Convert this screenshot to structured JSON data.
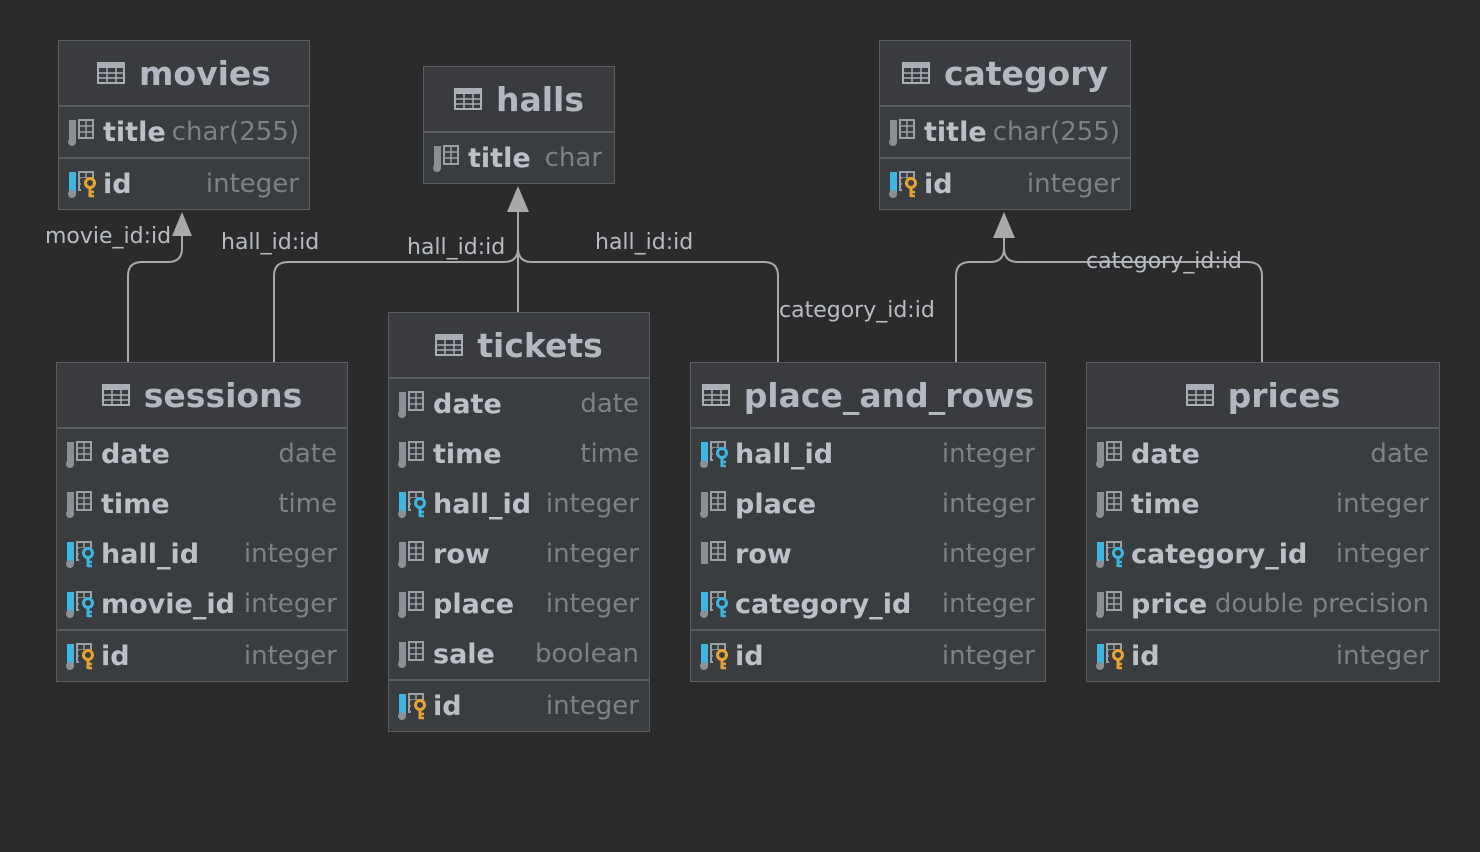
{
  "tables": {
    "movies": {
      "name": "movies",
      "columns": [
        {
          "name": "title",
          "type": "char(255)",
          "icon": "column-icon"
        }
      ],
      "pk": {
        "name": "id",
        "type": "integer",
        "icon": "primary-key-icon"
      }
    },
    "halls": {
      "name": "halls",
      "columns": [
        {
          "name": "title",
          "type": "char",
          "icon": "column-icon"
        }
      ]
    },
    "category": {
      "name": "category",
      "columns": [
        {
          "name": "title",
          "type": "char(255)",
          "icon": "column-icon"
        }
      ],
      "pk": {
        "name": "id",
        "type": "integer",
        "icon": "primary-key-icon"
      }
    },
    "sessions": {
      "name": "sessions",
      "columns": [
        {
          "name": "date",
          "type": "date",
          "icon": "column-icon"
        },
        {
          "name": "time",
          "type": "time",
          "icon": "column-icon"
        },
        {
          "name": "hall_id",
          "type": "integer",
          "icon": "foreign-key-icon"
        },
        {
          "name": "movie_id",
          "type": "integer",
          "icon": "foreign-key-icon"
        }
      ],
      "pk": {
        "name": "id",
        "type": "integer",
        "icon": "primary-key-icon"
      }
    },
    "tickets": {
      "name": "tickets",
      "columns": [
        {
          "name": "date",
          "type": "date",
          "icon": "column-icon"
        },
        {
          "name": "time",
          "type": "time",
          "icon": "column-icon"
        },
        {
          "name": "hall_id",
          "type": "integer",
          "icon": "foreign-key-icon"
        },
        {
          "name": "row",
          "type": "integer",
          "icon": "column-icon"
        },
        {
          "name": "place",
          "type": "integer",
          "icon": "column-icon"
        },
        {
          "name": "sale",
          "type": "boolean",
          "icon": "column-icon"
        }
      ],
      "pk": {
        "name": "id",
        "type": "integer",
        "icon": "primary-key-icon"
      }
    },
    "place_and_rows": {
      "name": "place_and_rows",
      "columns": [
        {
          "name": "hall_id",
          "type": "integer",
          "icon": "foreign-key-icon"
        },
        {
          "name": "place",
          "type": "integer",
          "icon": "column-icon"
        },
        {
          "name": "row",
          "type": "integer",
          "icon": "column-icon-nullable"
        },
        {
          "name": "category_id",
          "type": "integer",
          "icon": "foreign-key-icon"
        }
      ],
      "pk": {
        "name": "id",
        "type": "integer",
        "icon": "primary-key-icon"
      }
    },
    "prices": {
      "name": "prices",
      "columns": [
        {
          "name": "date",
          "type": "date",
          "icon": "column-icon"
        },
        {
          "name": "time",
          "type": "integer",
          "icon": "column-icon"
        },
        {
          "name": "category_id",
          "type": "integer",
          "icon": "foreign-key-icon"
        },
        {
          "name": "price",
          "type": "double precision",
          "icon": "column-icon"
        }
      ],
      "pk": {
        "name": "id",
        "type": "integer",
        "icon": "primary-key-icon"
      }
    }
  },
  "relations": [
    {
      "label": "movie_id:id",
      "from": "sessions",
      "to": "movies"
    },
    {
      "label": "hall_id:id",
      "from": "sessions",
      "to": "halls"
    },
    {
      "label": "hall_id:id",
      "from": "tickets",
      "to": "halls"
    },
    {
      "label": "hall_id:id",
      "from": "place_and_rows",
      "to": "halls"
    },
    {
      "label": "category_id:id",
      "from": "place_and_rows",
      "to": "category"
    },
    {
      "label": "category_id:id",
      "from": "prices",
      "to": "category"
    }
  ],
  "colors": {
    "background": "#2b2b2b",
    "table_fill": "#3a3d40",
    "border": "#5a5d60",
    "edge": "#a9a9a9",
    "fk_accent": "#3fb6e0",
    "pk_accent": "#e6a532"
  }
}
